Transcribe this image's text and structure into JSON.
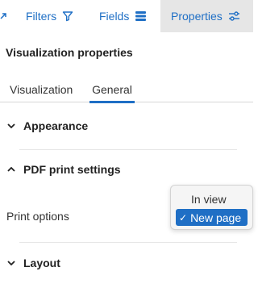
{
  "toolbar": {
    "filters_label": "Filters",
    "fields_label": "Fields",
    "properties_label": "Properties",
    "left_stub_icon": "arrow-icon",
    "filters_icon": "funnel-icon",
    "fields_icon": "fields-icon",
    "properties_icon": "sliders-icon"
  },
  "panel": {
    "title": "Visualization properties",
    "tabs": [
      {
        "label": "Visualization",
        "selected": false
      },
      {
        "label": "General",
        "selected": true
      }
    ],
    "sections": {
      "appearance": {
        "label": "Appearance",
        "expanded": false
      },
      "pdf_print_settings": {
        "label": "PDF print settings",
        "expanded": true
      },
      "layout": {
        "label": "Layout",
        "expanded": false
      }
    },
    "print_options": {
      "label": "Print options",
      "options": [
        "In view",
        "New page"
      ],
      "selected": "New page"
    }
  },
  "colors": {
    "accent": "#1f6fc5",
    "active_toolbar_bg": "#e6e6e6",
    "dropdown_bg": "#f5f5f5"
  }
}
